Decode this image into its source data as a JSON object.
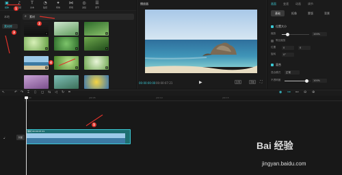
{
  "toolbar": {
    "items": [
      {
        "icon": "media-icon",
        "label": "媒体"
      },
      {
        "icon": "audio-icon",
        "label": "音频"
      },
      {
        "icon": "text-icon",
        "label": "文本"
      },
      {
        "icon": "sticker-icon",
        "label": "贴纸"
      },
      {
        "icon": "effects-icon",
        "label": "特效"
      },
      {
        "icon": "transition-icon",
        "label": "转场"
      },
      {
        "icon": "filter-icon",
        "label": "滤镜"
      },
      {
        "icon": "adjust-icon",
        "label": "调节"
      }
    ]
  },
  "sidebar": {
    "items": [
      {
        "label": "本地"
      },
      {
        "label": "素材库"
      }
    ]
  },
  "search": {
    "value": "素材",
    "icon": "search-icon"
  },
  "player": {
    "title": "播放器",
    "timecode": "00:00:00:00",
    "duration": "00:00:07:21",
    "ratio_label": "比例",
    "fullscreen_label": "原始"
  },
  "props": {
    "tabs": [
      "画面",
      "变速",
      "动画",
      "调节"
    ],
    "subtabs": [
      "基础",
      "抠像",
      "蒙版",
      "背景"
    ],
    "section_position": "位置大小",
    "scale_label": "缩放",
    "scale_value": "100%",
    "scale_level": 0.2,
    "uniform_label": "等比缩放",
    "pos_label": "位置",
    "pos_x": "0",
    "pos_y": "0",
    "rotate_label": "旋转",
    "rotate_value": "0°",
    "section_blend": "混合",
    "blend_mode_label": "混合模式",
    "blend_mode_value": "正常",
    "opacity_label": "不透明度",
    "opacity_value": "100%",
    "opacity_level": 0.85
  },
  "timeline": {
    "ticks": [
      "00:00",
      "|00:05",
      "|00:10",
      "|00:15"
    ],
    "clip_label": "素材 00:00:07:21",
    "cover_label": "封面",
    "lock_icon": "lock-icon"
  },
  "annotations": [
    "1",
    "2",
    "3",
    "4",
    "5"
  ],
  "watermark": {
    "brand": "Bai 经验",
    "url": "jingyan.baidu.com"
  }
}
